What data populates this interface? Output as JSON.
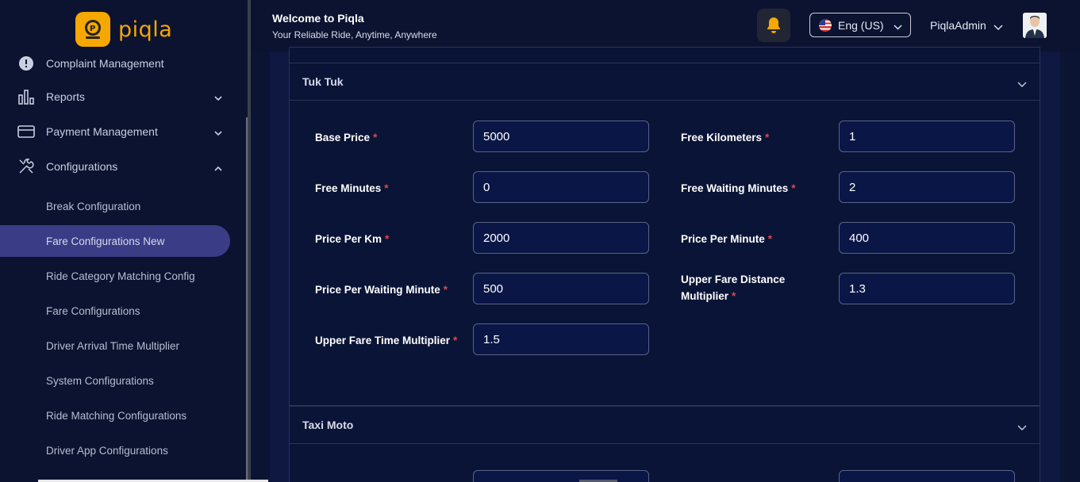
{
  "app": {
    "name": "piqla"
  },
  "header": {
    "welcome": "Welcome to Piqla",
    "tagline": "Your Reliable Ride, Anytime, Anywhere",
    "language": "Eng (US)",
    "user": "PiqlaAdmin"
  },
  "sidebar": {
    "items": [
      {
        "label": "Complaint Management",
        "icon": "alert-circle-icon"
      },
      {
        "label": "Reports",
        "icon": "bar-chart-icon"
      },
      {
        "label": "Payment Management",
        "icon": "credit-card-icon"
      },
      {
        "label": "Configurations",
        "icon": "tools-icon"
      }
    ],
    "sub_items": [
      "Break Configuration",
      "Fare Configurations New",
      "Ride Category Matching Config",
      "Fare Configurations",
      "Driver Arrival Time Multiplier",
      "System Configurations",
      "Ride Matching Configurations",
      "Driver App Configurations"
    ],
    "active_sub_item": "Fare Configurations New"
  },
  "sections": [
    {
      "title": "Tuk Tuk",
      "fields": [
        {
          "label": "Base Price",
          "value": "5000"
        },
        {
          "label": "Free Kilometers",
          "value": "1"
        },
        {
          "label": "Free Minutes",
          "value": "0"
        },
        {
          "label": "Free Waiting Minutes",
          "value": "2"
        },
        {
          "label": "Price Per Km",
          "value": "2000"
        },
        {
          "label": "Price Per Minute",
          "value": "400"
        },
        {
          "label": "Price Per Waiting Minute",
          "value": "500"
        },
        {
          "label": "Upper Fare Distance Multiplier",
          "value": "1.3"
        },
        {
          "label": "Upper Fare Time Multiplier",
          "value": "1.5"
        }
      ]
    },
    {
      "title": "Taxi Moto",
      "fields": []
    }
  ],
  "required_marker": "*",
  "colors": {
    "accent": "#f6a700",
    "active_nav": "#3a3d85",
    "required": "#e0474c"
  }
}
